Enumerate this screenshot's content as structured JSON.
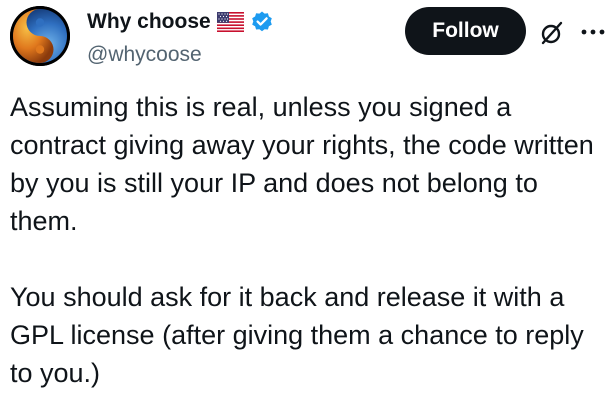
{
  "author": {
    "display_name": "Why choose",
    "handle": "@whycoose",
    "flag": "us-flag",
    "badge": "verified-badge",
    "avatar": "yin-yang-avatar",
    "badge_color": "#1d9bf0"
  },
  "actions": {
    "follow_label": "Follow",
    "grok_icon": "slashed-circle-icon",
    "more_icon": "more-icon"
  },
  "post": {
    "text": "Assuming this is real, unless you signed a\ncontract giving away your rights, the code written\nby you is still your IP and does not belong to\nthem.\n\nYou should ask for it back and release it with a\nGPL license (after giving them a chance to reply\nto you.)"
  },
  "colors": {
    "text": "#0f1419",
    "secondary_text": "#536471",
    "button_bg": "#0f1419",
    "button_text": "#ffffff",
    "background": "#ffffff"
  }
}
